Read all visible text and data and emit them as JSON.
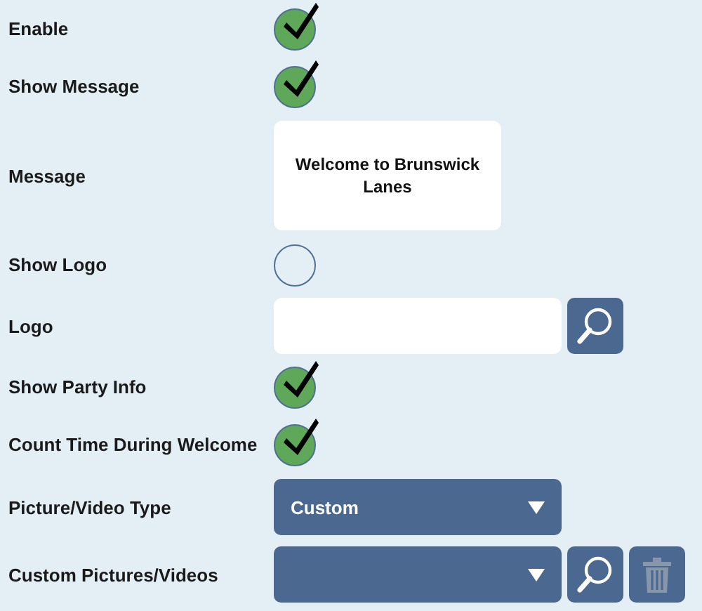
{
  "fields": [
    {
      "kind": "checkbox",
      "label": "Enable",
      "checked": true
    },
    {
      "kind": "checkbox",
      "label": "Show Message",
      "checked": true
    },
    {
      "kind": "textarea",
      "label": "Message",
      "value": "Welcome to Brunswick Lanes"
    },
    {
      "kind": "checkbox",
      "label": "Show Logo",
      "checked": false
    },
    {
      "kind": "browse",
      "label": "Logo"
    },
    {
      "kind": "checkbox",
      "label": "Show Party Info",
      "checked": true
    },
    {
      "kind": "checkbox",
      "label": "Count Time During Welcome",
      "checked": true
    },
    {
      "kind": "select",
      "label": "Picture/Video Type",
      "value": "Custom"
    },
    {
      "kind": "select-actions",
      "label": "Custom Pictures/Videos",
      "delete_disabled": true
    }
  ]
}
